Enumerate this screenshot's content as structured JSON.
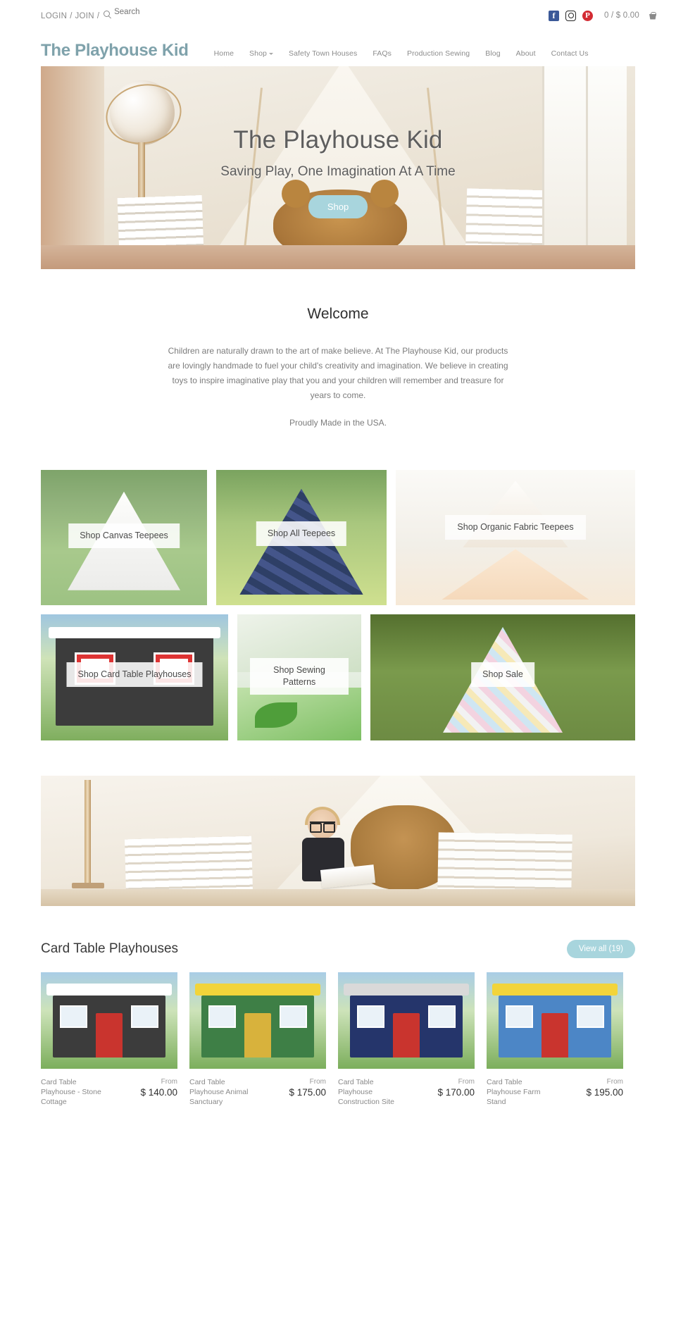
{
  "utility": {
    "login_label": "LOGIN",
    "sep1": "/",
    "join_label": "JOIN",
    "sep2": "/",
    "search_placeholder": "Search",
    "search_value": "",
    "social": [
      {
        "name": "facebook-icon",
        "glyph": "f"
      },
      {
        "name": "instagram-icon",
        "glyph": ""
      },
      {
        "name": "pinterest-icon",
        "glyph": "P"
      }
    ],
    "cart_text": "0 / $ 0.00"
  },
  "header": {
    "logo": "The Playhouse Kid",
    "nav": [
      {
        "label": "Home",
        "has_caret": false
      },
      {
        "label": "Shop",
        "has_caret": true
      },
      {
        "label": "Safety Town Houses",
        "has_caret": false
      },
      {
        "label": "FAQs",
        "has_caret": false
      },
      {
        "label": "Production Sewing",
        "has_caret": false
      },
      {
        "label": "Blog",
        "has_caret": false
      },
      {
        "label": "About",
        "has_caret": false
      },
      {
        "label": "Contact Us",
        "has_caret": false
      }
    ]
  },
  "hero": {
    "title": "The Playhouse Kid",
    "subtitle": "Saving Play, One Imagination At A Time",
    "button_label": "Shop"
  },
  "welcome": {
    "heading": "Welcome",
    "paragraph": "Children are naturally drawn to the art of make believe.  At The Playhouse Kid, our products are lovingly handmade to fuel your child's creativity and imagination.  We believe in creating toys to inspire imaginative play that you and your children will remember and treasure for years to come.",
    "paragraph2": "Proudly Made in the USA."
  },
  "collage": {
    "row1": [
      {
        "label": "Shop Canvas Teepees",
        "style": "im-canvas"
      },
      {
        "label": "Shop All Teepees",
        "style": "im-all"
      },
      {
        "label": "Shop Organic Fabric Teepees",
        "style": "im-org"
      }
    ],
    "row2": [
      {
        "label": "Shop Card Table Playhouses",
        "style": "im-card"
      },
      {
        "label": "Shop Sewing Patterns",
        "style": "im-sew"
      },
      {
        "label": "Shop Sale",
        "style": "im-sale"
      }
    ]
  },
  "products": {
    "section_title": "Card Table Playhouses",
    "view_all_label": "View all (19)",
    "from_label": "From",
    "items": [
      {
        "name": "Card Table Playhouse - Stone Cottage",
        "from": "From",
        "price": "$ 140.00",
        "roof_color": "#ffffff",
        "body_color": "#3c3c3c",
        "accent_color": "#c9342e"
      },
      {
        "name": "Card Table Playhouse Animal Sanctuary",
        "from": "From",
        "price": "$ 175.00",
        "roof_color": "#f2d43a",
        "body_color": "#3e7f46",
        "accent_color": "#d8b23c"
      },
      {
        "name": "Card Table Playhouse Construction Site",
        "from": "From",
        "price": "$ 170.00",
        "roof_color": "#d9d9d9",
        "body_color": "#25356b",
        "accent_color": "#c9342e"
      },
      {
        "name": "Card Table Playhouse Farm Stand",
        "from": "From",
        "price": "$ 195.00",
        "roof_color": "#f2d43a",
        "body_color": "#4c86c6",
        "accent_color": "#c9342e"
      }
    ]
  }
}
